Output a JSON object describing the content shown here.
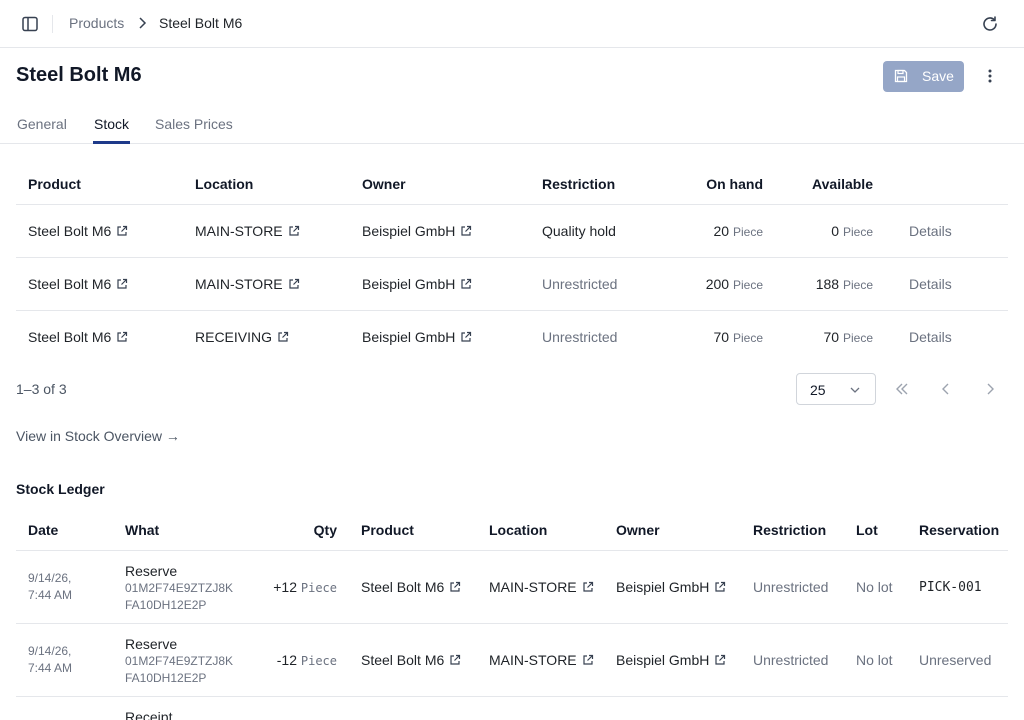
{
  "breadcrumb": {
    "parent": "Products",
    "current": "Steel Bolt M6"
  },
  "page": {
    "title": "Steel Bolt M6",
    "save_label": "Save"
  },
  "tabs": [
    {
      "label": "General"
    },
    {
      "label": "Stock"
    },
    {
      "label": "Sales Prices"
    }
  ],
  "stock": {
    "headers": {
      "product": "Product",
      "location": "Location",
      "owner": "Owner",
      "restriction": "Restriction",
      "on_hand": "On hand",
      "available": "Available"
    },
    "rows": [
      {
        "product": "Steel Bolt M6",
        "location": "MAIN-STORE",
        "owner": "Beispiel GmbH",
        "restriction": "Quality hold",
        "on_hand": "20",
        "on_hand_unit": "Piece",
        "available": "0",
        "available_unit": "Piece",
        "action": "Details"
      },
      {
        "product": "Steel Bolt M6",
        "location": "MAIN-STORE",
        "owner": "Beispiel GmbH",
        "restriction": "Unrestricted",
        "on_hand": "200",
        "on_hand_unit": "Piece",
        "available": "188",
        "available_unit": "Piece",
        "action": "Details"
      },
      {
        "product": "Steel Bolt M6",
        "location": "RECEIVING",
        "owner": "Beispiel GmbH",
        "restriction": "Unrestricted",
        "on_hand": "70",
        "on_hand_unit": "Piece",
        "available": "70",
        "available_unit": "Piece",
        "action": "Details"
      }
    ],
    "pagination": {
      "range": "1–3 of 3",
      "page_size": "25"
    },
    "overview_link": "View in Stock Overview →"
  },
  "ledger": {
    "title": "Stock Ledger",
    "headers": {
      "date": "Date",
      "what": "What",
      "qty": "Qty",
      "product": "Product",
      "location": "Location",
      "owner": "Owner",
      "restriction": "Restriction",
      "lot": "Lot",
      "reservation": "Reservation"
    },
    "rows": [
      {
        "date_line1": "9/14/26,",
        "date_line2": "7:44 AM",
        "what": "Reserve",
        "ref_line1": "01M2F74E9ZTZJ8K",
        "ref_line2": "FA10DH12E2P",
        "qty": "+12",
        "qty_unit": "Piece",
        "product": "Steel Bolt M6",
        "location": "MAIN-STORE",
        "owner": "Beispiel GmbH",
        "restriction": "Unrestricted",
        "lot": "No lot",
        "reservation": "PICK-001"
      },
      {
        "date_line1": "9/14/26,",
        "date_line2": "7:44 AM",
        "what": "Reserve",
        "ref_line1": "01M2F74E9ZTZJ8K",
        "ref_line2": "FA10DH12E2P",
        "qty": "-12",
        "qty_unit": "Piece",
        "product": "Steel Bolt M6",
        "location": "MAIN-STORE",
        "owner": "Beispiel GmbH",
        "restriction": "Unrestricted",
        "lot": "No lot",
        "reservation": "Unreserved"
      },
      {
        "what": "Receipt"
      }
    ]
  },
  "colors": {
    "accent": "#1e3a8a",
    "save_button": "#95a6c7",
    "border": "#e5e7eb",
    "muted_text": "#6b7280"
  },
  "icons": {
    "sidebar": "sidebar-toggle-icon",
    "refresh": "refresh-icon",
    "save": "floppy-disk-icon",
    "more": "vertical-dots-icon",
    "external": "external-link-icon"
  }
}
